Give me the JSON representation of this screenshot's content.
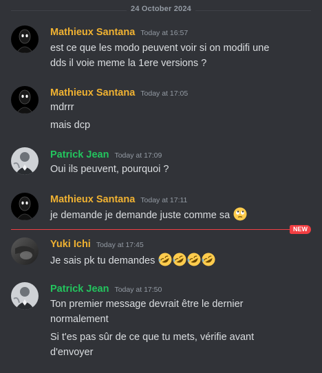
{
  "date_divider": "24 October 2024",
  "new_label": "NEW",
  "messages": [
    {
      "author": "Mathieux Santana",
      "time": "Today at 16:57",
      "lines": [
        "est ce que les modo peuvent voir si on modifi une",
        "dds il voie meme la 1ere versions ?"
      ]
    },
    {
      "author": "Mathieux Santana",
      "time": "Today at 17:05",
      "lines": [
        "mdrrr",
        "mais dcp"
      ]
    },
    {
      "author": "Patrick Jean",
      "time": "Today at 17:09",
      "lines": [
        "Oui ils peuvent, pourquoi ?"
      ]
    },
    {
      "author": "Mathieux Santana",
      "time": "Today at 17:11",
      "lines": [
        "je demande je demande juste comme sa"
      ],
      "emoji": "rolling-eyes-emoji"
    },
    {
      "author": "Yuki Ichi",
      "time": "Today at 17:45",
      "lines": [
        "Je sais pk tu demandes"
      ],
      "emoji": "rofl-emoji x4"
    },
    {
      "author": "Patrick Jean",
      "time": "Today at 17:50",
      "lines": [
        "Ton premier message devrait être le dernier",
        "normalement",
        "Si t'es pas sûr de ce que tu mets, vérifie avant",
        "d'envoyer"
      ]
    }
  ],
  "colors": {
    "background": "#313338",
    "yellow_name": "#f0b232",
    "green_name": "#23c55e",
    "new_red": "#f23f43"
  }
}
